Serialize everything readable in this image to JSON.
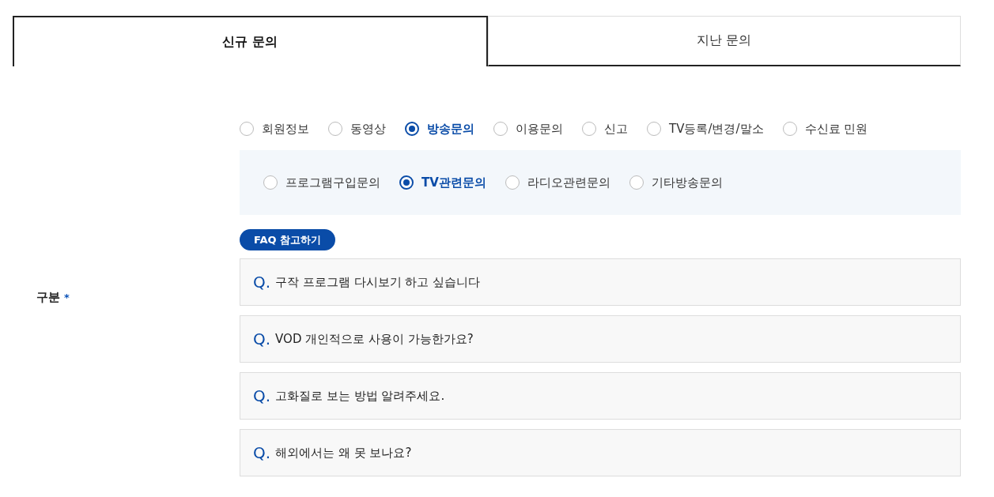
{
  "tabs": [
    {
      "label": "신규 문의",
      "selected": true
    },
    {
      "label": "지난 문의",
      "selected": false
    }
  ],
  "field": {
    "label": "구분",
    "required_mark": "*"
  },
  "categories": [
    {
      "label": "회원정보",
      "selected": false
    },
    {
      "label": "동영상",
      "selected": false
    },
    {
      "label": "방송문의",
      "selected": true
    },
    {
      "label": "이용문의",
      "selected": false
    },
    {
      "label": "신고",
      "selected": false
    },
    {
      "label": "TV등록/변경/말소",
      "selected": false
    },
    {
      "label": "수신료 민원",
      "selected": false
    }
  ],
  "subcategories": [
    {
      "label": "프로그램구입문의",
      "selected": false
    },
    {
      "label": "TV관련문의",
      "selected": true
    },
    {
      "label": "라디오관련문의",
      "selected": false
    },
    {
      "label": "기타방송문의",
      "selected": false
    }
  ],
  "faq_button": "FAQ 참고하기",
  "faq": [
    {
      "marker": "Q.",
      "question": "구작 프로그램 다시보기 하고 싶습니다"
    },
    {
      "marker": "Q.",
      "question": "VOD 개인적으로 사용이 가능한가요?"
    },
    {
      "marker": "Q.",
      "question": "고화질로 보는 방법 알려주세요."
    },
    {
      "marker": "Q.",
      "question": "해외에서는 왜 못 보나요?"
    }
  ]
}
